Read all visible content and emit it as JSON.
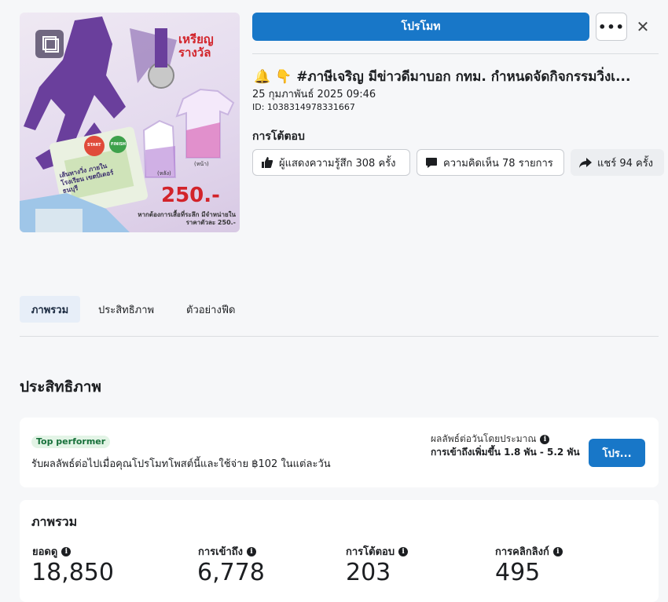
{
  "header": {
    "promote_label": "โปรโมท",
    "more_label": "•••",
    "close_label": "✕"
  },
  "thumbnail": {
    "medal_heading": "เหรียญ\nรางวัล",
    "route_label": "เส้นทางวิ่ง ภายในโรงเรียน เขตบีเดอร์ธนบุรี",
    "price": "250.-",
    "note": "หากต้องการเสื้อที่ระลึก มีจำหน่ายในราคาตัวละ 250.-",
    "back_label": "(หลัง)",
    "front_label": "(หน้า)",
    "start_label": "START",
    "finish_label": "FINISH"
  },
  "post": {
    "emoji": "🔔 👇",
    "title": "#ภาษีเจริญ มีข่าวดีมาบอก กทม. กำหนดจัดกิจกรรมวิ่งเ...",
    "date": "25 กุมภาพันธ์ 2025 09:46",
    "id": "ID: 1038314978331667"
  },
  "engagement": {
    "heading": "การโต้ตอบ",
    "reactions": "ผู้แสดงความรู้สึก 308 ครั้ง",
    "comments": "ความคิดเห็น 78 รายการ",
    "shares": "แชร์ 94 ครั้ง"
  },
  "tabs": [
    {
      "label": "ภาพรวม",
      "active": true
    },
    {
      "label": "ประสิทธิภาพ",
      "active": false
    },
    {
      "label": "ตัวอย่างฟีด",
      "active": false
    }
  ],
  "performance": {
    "heading": "ประสิทธิภาพ",
    "badge": "Top performer",
    "recommendation": "รับผลลัพธ์ต่อไปเมื่อคุณโปรโมทโพสต์นี้และใช้จ่าย ฿102 ในแต่ละวัน",
    "estimate_label": "ผลลัพธ์ต่อวันโดยประมาณ",
    "estimate_value": "การเข้าถึงเพิ่มขึ้น 1.8 พัน - 5.2 พัน",
    "promote_short": "โปร..."
  },
  "overview": {
    "heading": "ภาพรวม",
    "metrics": [
      {
        "label": "ยอดดู",
        "value": "18,850"
      },
      {
        "label": "การเข้าถึง",
        "value": "6,778"
      },
      {
        "label": "การโต้ตอบ",
        "value": "203"
      },
      {
        "label": "การคลิกลิงก์",
        "value": "495"
      }
    ]
  },
  "colors": {
    "accent": "#1877c8",
    "badge_bg": "#e3f4e6",
    "badge_text": "#17703a",
    "thumb_purple": "#6a3f9c",
    "thumb_red": "#d2232a"
  }
}
